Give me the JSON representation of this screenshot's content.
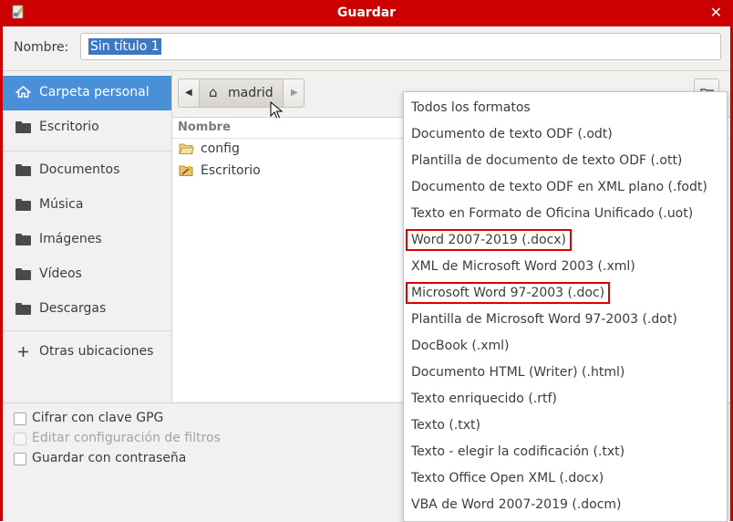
{
  "window": {
    "title": "Guardar",
    "close_symbol": "✕"
  },
  "name_field": {
    "label": "Nombre:",
    "value": "Sin título 1"
  },
  "sidebar": {
    "items": [
      {
        "label": "Carpeta personal",
        "icon": "home-icon"
      },
      {
        "label": "Escritorio",
        "icon": "folder-icon"
      },
      {
        "label": "Documentos",
        "icon": "folder-icon"
      },
      {
        "label": "Música",
        "icon": "folder-icon"
      },
      {
        "label": "Imágenes",
        "icon": "folder-icon"
      },
      {
        "label": "Vídeos",
        "icon": "folder-icon"
      },
      {
        "label": "Descargas",
        "icon": "folder-icon"
      },
      {
        "label": "Otras ubicaciones",
        "icon": "plus-icon"
      }
    ]
  },
  "pathbar": {
    "current": "madrid"
  },
  "files": {
    "column_header": "Nombre",
    "rows": [
      {
        "name": "config",
        "icon": "folder-open-icon"
      },
      {
        "name": "Escritorio",
        "icon": "desktop-folder-icon"
      }
    ]
  },
  "options": {
    "encrypt_gpg": {
      "label": "Cifrar con clave GPG",
      "checked": false,
      "enabled": true
    },
    "edit_filter": {
      "label": "Editar configuración de filtros",
      "checked": false,
      "enabled": false
    },
    "save_password": {
      "label": "Guardar con contraseña",
      "checked": false,
      "enabled": true
    }
  },
  "format_menu": {
    "items": [
      "Todos los formatos",
      "Documento de texto ODF (.odt)",
      "Plantilla de documento de texto ODF (.ott)",
      "Documento de texto ODF en XML plano (.fodt)",
      "Texto en Formato de Oficina Unificado (.uot)",
      "Word 2007-2019 (.docx)",
      "XML de Microsoft Word 2003 (.xml)",
      "Microsoft Word 97-2003 (.doc)",
      "Plantilla de Microsoft Word 97-2003 (.dot)",
      "DocBook (.xml)",
      "Documento HTML (Writer) (.html)",
      "Texto enriquecido (.rtf)",
      "Texto (.txt)",
      "Texto - elegir la codificación (.txt)",
      "Texto Office Open XML (.docx)",
      "VBA de Word 2007-2019 (.docm)"
    ],
    "highlighted": [
      "Word 2007-2019 (.docx)",
      "Microsoft Word 97-2003 (.doc)"
    ]
  },
  "colors": {
    "titlebar": "#cc0000",
    "selection": "#4a90d9",
    "highlight_box": "#dd0000"
  }
}
